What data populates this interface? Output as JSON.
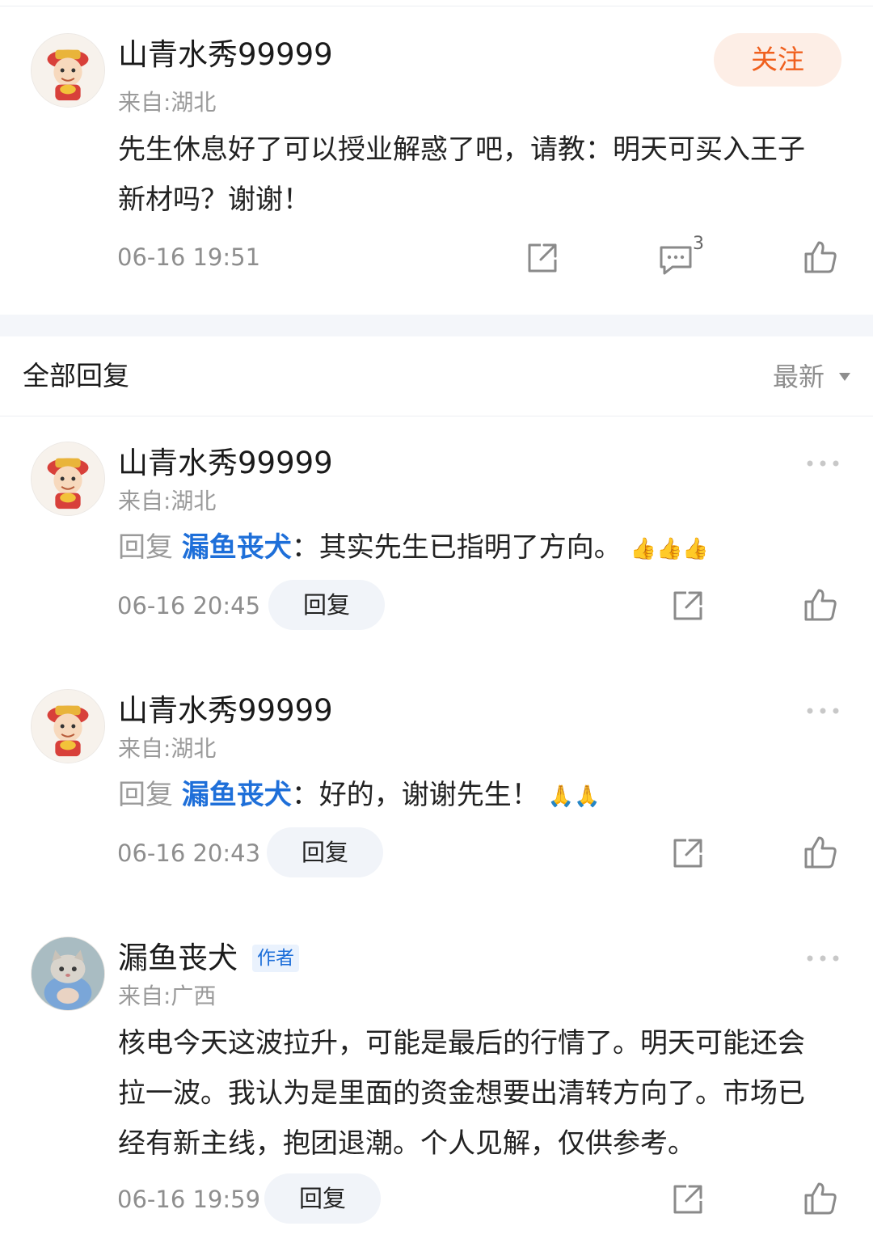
{
  "post": {
    "username": "山青水秀99999",
    "location": "来自:湖北",
    "follow_label": "关注",
    "content": "先生休息好了可以授业解惑了吧，请教：明天可买入王子新材吗？谢谢！",
    "time": "06-16 19:51",
    "comment_count": "3"
  },
  "replies_section": {
    "title": "全部回复",
    "sort_label": "最新"
  },
  "replies": [
    {
      "username": "山青水秀99999",
      "location": "来自:湖北",
      "reply_prefix": "回复",
      "reply_to": "漏鱼丧犬",
      "text": "：其实先生已指明了方向。",
      "emoji": "👍👍👍",
      "time": "06-16 20:45",
      "reply_label": "回复"
    },
    {
      "username": "山青水秀99999",
      "location": "来自:湖北",
      "reply_prefix": "回复",
      "reply_to": "漏鱼丧犬",
      "text": "：好的，谢谢先生！",
      "emoji": "🙏🙏",
      "time": "06-16 20:43",
      "reply_label": "回复"
    },
    {
      "username": "漏鱼丧犬",
      "badge": "作者",
      "location": "来自:广西",
      "content": "核电今天这波拉升，可能是最后的行情了。明天可能还会拉一波。我认为是里面的资金想要出清转方向了。市场已经有新主线，抱团退潮。个人见解，仅供参考。",
      "time": "06-16 19:59",
      "reply_label": "回复"
    }
  ],
  "icons": {
    "share": "share-icon",
    "comment": "comment-icon",
    "like": "thumbs-up-icon",
    "more": "more-dots-icon",
    "caret": "caret-down-icon"
  },
  "colors": {
    "accent_orange": "#f0601e",
    "follow_bg": "#fdeee6",
    "link_blue": "#1e6fd9",
    "reply_btn_bg": "#f1f4f9",
    "secondary_text": "#9a9a9a"
  }
}
